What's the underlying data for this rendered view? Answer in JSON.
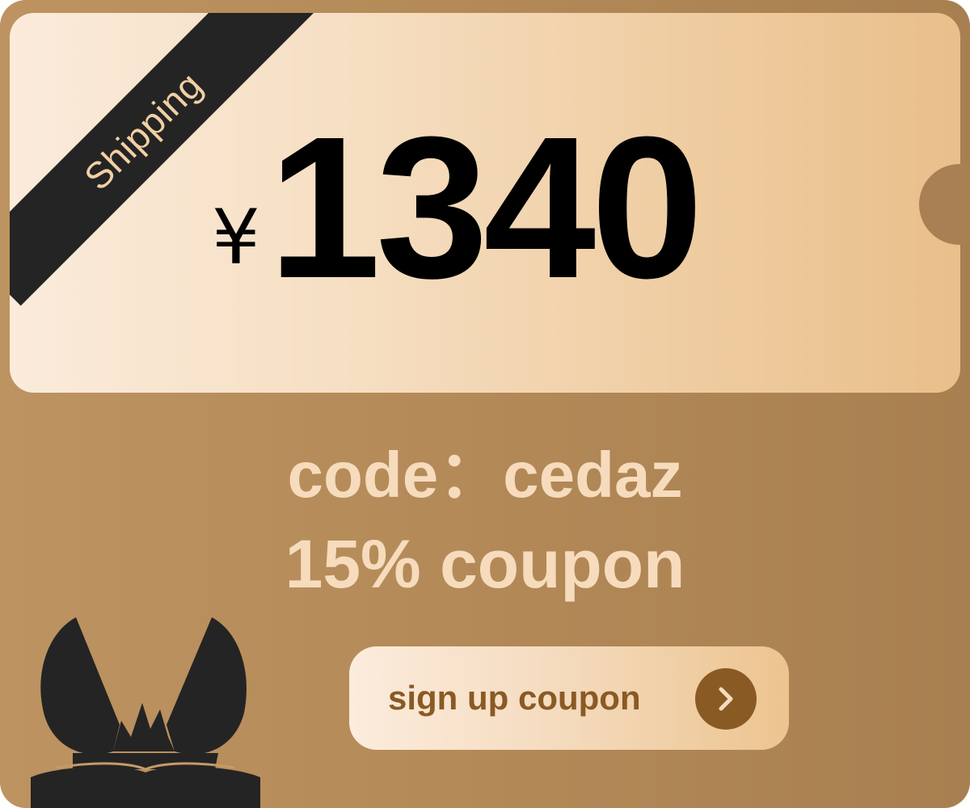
{
  "ribbon": {
    "label": "Shipping"
  },
  "price": {
    "currency": "¥",
    "amount": "1340"
  },
  "promo": {
    "code_line": "code：cedaz",
    "discount_line": "15% coupon"
  },
  "cta": {
    "label": "sign up coupon",
    "icon": "chevron-right-icon"
  },
  "colors": {
    "card_bg": "#b48a58",
    "ticket_light": "#fbebdb",
    "ticket_dark": "#e9bf8b",
    "ribbon_bg": "#242424",
    "ribbon_text": "#f2cfa3",
    "promo_text": "#f6dcbd",
    "cta_text": "#8a5a25"
  }
}
